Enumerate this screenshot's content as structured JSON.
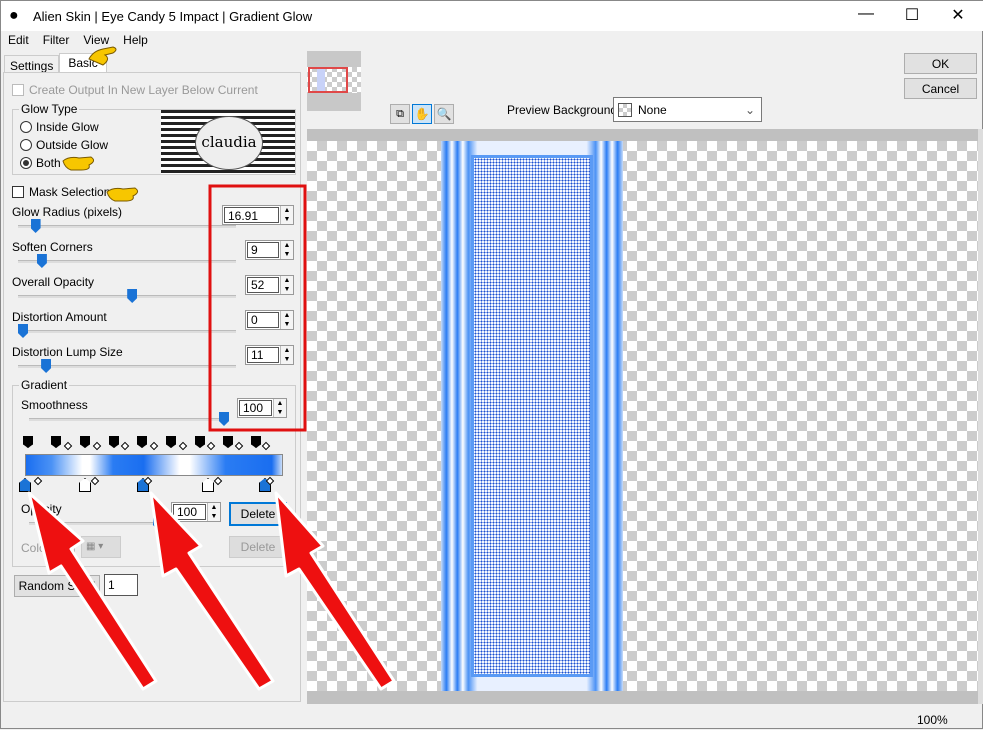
{
  "window": {
    "title": "Alien Skin | Eye Candy 5 Impact | Gradient Glow",
    "minimize": "—",
    "maximize": "☐",
    "close": "✕"
  },
  "menu": [
    "Edit",
    "Filter",
    "View",
    "Help"
  ],
  "tabs": [
    {
      "label": "Settings",
      "active": false
    },
    {
      "label": "Basic",
      "active": true
    }
  ],
  "create_output_label": "Create Output In New Layer Below Current",
  "glow_type": {
    "title": "Glow Type",
    "options": [
      "Inside Glow",
      "Outside Glow",
      "Both"
    ],
    "selected": "Both"
  },
  "logo_text": "claudia",
  "mask_selection": {
    "label": "Mask Selection",
    "checked": false
  },
  "sliders": [
    {
      "label": "Glow Radius (pixels)",
      "value": "16.91",
      "fraction": 0.06
    },
    {
      "label": "Soften Corners",
      "value": "9",
      "fraction": 0.09
    },
    {
      "label": "Overall Opacity",
      "value": "52",
      "fraction": 0.52
    },
    {
      "label": "Distortion Amount",
      "value": "0",
      "fraction": 0.0
    },
    {
      "label": "Distortion Lump Size",
      "value": "11",
      "fraction": 0.11
    }
  ],
  "gradient": {
    "title": "Gradient",
    "smoothness_label": "Smoothness",
    "smoothness": "100",
    "opacity_label": "Opacity",
    "opacity": "100",
    "delete_label": "Delete",
    "color_label": "Color",
    "delete_color_label": "Delete",
    "colors": {
      "blue": "#1a73f0",
      "white": "#ffffff"
    }
  },
  "random_seed": {
    "label": "Random Seed",
    "value": "1"
  },
  "buttons": {
    "ok": "OK",
    "cancel": "Cancel"
  },
  "preview_background": {
    "label": "Preview Background:",
    "value": "None"
  },
  "zoom": "100%"
}
